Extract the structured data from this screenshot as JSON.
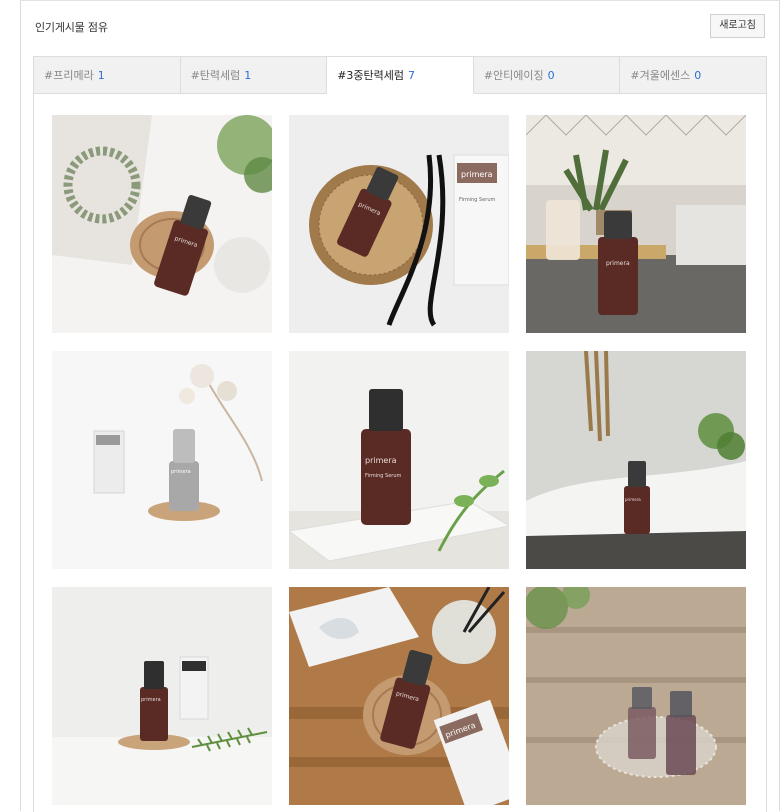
{
  "panel": {
    "title": "인기게시물 점유",
    "refresh_label": "새로고침"
  },
  "tabs": [
    {
      "label": "#프리메라",
      "count": "1",
      "active": false
    },
    {
      "label": "#탄력세럼",
      "count": "1",
      "active": false
    },
    {
      "label": "#3중탄력세럼",
      "count": "7",
      "active": true
    },
    {
      "label": "#안티에이징",
      "count": "0",
      "active": false
    },
    {
      "label": "#겨울에센스",
      "count": "0",
      "active": false
    }
  ],
  "product": {
    "brand": "primera",
    "name": "Firming Serum"
  },
  "colors": {
    "accent": "#2a6fd6",
    "serum": "#5a2a24",
    "cap": "#3a3a3a"
  }
}
